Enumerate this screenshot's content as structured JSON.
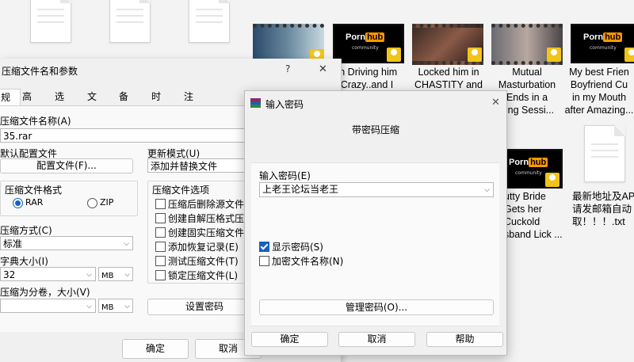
{
  "explorer": {
    "tiles": [
      {
        "title": "m Driving him\nCrazy..and I\n...",
        "kind": "pornhub"
      },
      {
        "title": "Locked him in\nCHASTITY and\n...",
        "kind": "scene"
      },
      {
        "title": "Mutual\nMasturbation\nEnds in a\nging Sessi...",
        "kind": "scene2"
      },
      {
        "title": "My best Frien\nBoyfriend Cu\nin my Mouth\nafter Amazing...",
        "kind": "pornhub"
      },
      {
        "title": "utty Bride\nGets her\nCuckold\nsband Lick ...",
        "kind": "pornhub"
      },
      {
        "title": "最新地址及AP\n请发邮箱自动\n取！！！.txt",
        "kind": "txt"
      }
    ],
    "player_badge": "Player",
    "pornhub_left": "Porn",
    "pornhub_right": "hub",
    "community": "community"
  },
  "archive_dialog": {
    "title": "压缩文件名和参数",
    "help_icon": "?",
    "close_icon": "✕",
    "tabs": [
      "规",
      "高级",
      "选项",
      "文件",
      "备份",
      "时间",
      "注释"
    ],
    "archive_name_label": "压缩文件名称(A)",
    "archive_name_value": "35.rar",
    "default_profile_label": "默认配置文件",
    "profile_button": "配置文件(F)...",
    "update_mode_label": "更新模式(U)",
    "update_mode_value": "添加并替换文件",
    "format_group_label": "压缩文件格式",
    "format_rar": "RAR",
    "format_zip": "ZIP",
    "method_label": "压缩方式(C)",
    "method_value": "标准",
    "dict_label": "字典大小(I)",
    "dict_value": "32",
    "dict_unit": "MB",
    "split_label": "压缩为分卷，大小(V)",
    "split_value": "",
    "split_unit": "MB",
    "options_group_label": "压缩文件选项",
    "options": [
      {
        "label": "压缩后删除源文件",
        "checked": false
      },
      {
        "label": "创建自解压格式压",
        "checked": false
      },
      {
        "label": "创建固实压缩文件",
        "checked": false
      },
      {
        "label": "添加恢复记录(E)",
        "checked": false
      },
      {
        "label": "测试压缩文件(T)",
        "checked": false
      },
      {
        "label": "锁定压缩文件(L)",
        "checked": false
      }
    ],
    "set_password_button": "设置密码",
    "ok_button": "确定",
    "cancel_button": "取消"
  },
  "password_dialog": {
    "title": "输入密码",
    "close_icon": "✕",
    "heading": "带密码压缩",
    "password_label": "输入密码(E)",
    "password_value": "上老王论坛当老王",
    "show_password_label": "显示密码(S)",
    "show_password_checked": true,
    "encrypt_names_label": "加密文件名称(N)",
    "encrypt_names_checked": false,
    "manage_button": "管理密码(O)...",
    "ok_button": "确定",
    "cancel_button": "取消",
    "help_button": "帮助"
  },
  "colors": {
    "accent": "#1560c0",
    "pornhub_orange": "#ff9900",
    "dialog_bg": "#f0f0f0"
  }
}
